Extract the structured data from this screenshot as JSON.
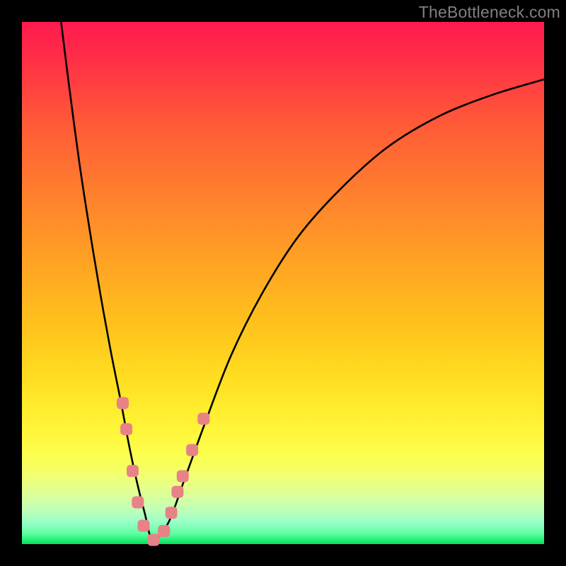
{
  "watermark": "TheBottleneck.com",
  "chart_data": {
    "type": "line",
    "title": "",
    "xlabel": "",
    "ylabel": "",
    "xlim": [
      0,
      100
    ],
    "ylim": [
      0,
      100
    ],
    "grid": false,
    "legend": false,
    "background": "red-yellow-green vertical gradient",
    "series": [
      {
        "name": "bottleneck-curve",
        "color": "#000000",
        "x": [
          7.5,
          9,
          11,
          13,
          15,
          17,
          19,
          20.5,
          22,
          23.5,
          25,
          28,
          31,
          35,
          40,
          46,
          53,
          61,
          70,
          80,
          90,
          100
        ],
        "y": [
          100,
          88,
          73,
          60,
          48,
          37,
          27,
          19,
          12,
          6,
          1,
          4,
          12,
          23,
          36,
          48,
          59,
          68,
          76,
          82,
          86,
          89
        ]
      }
    ],
    "markers": {
      "name": "data-points",
      "color": "#e78287",
      "shape": "rounded-square",
      "points": [
        {
          "x": 19.3,
          "y": 27
        },
        {
          "x": 20.0,
          "y": 22
        },
        {
          "x": 21.2,
          "y": 14
        },
        {
          "x": 22.2,
          "y": 8
        },
        {
          "x": 23.3,
          "y": 3.5
        },
        {
          "x": 25.2,
          "y": 0.8
        },
        {
          "x": 27.2,
          "y": 2.5
        },
        {
          "x": 28.6,
          "y": 6
        },
        {
          "x": 29.8,
          "y": 10
        },
        {
          "x": 30.8,
          "y": 13
        },
        {
          "x": 32.6,
          "y": 18
        },
        {
          "x": 34.8,
          "y": 24
        }
      ]
    }
  }
}
